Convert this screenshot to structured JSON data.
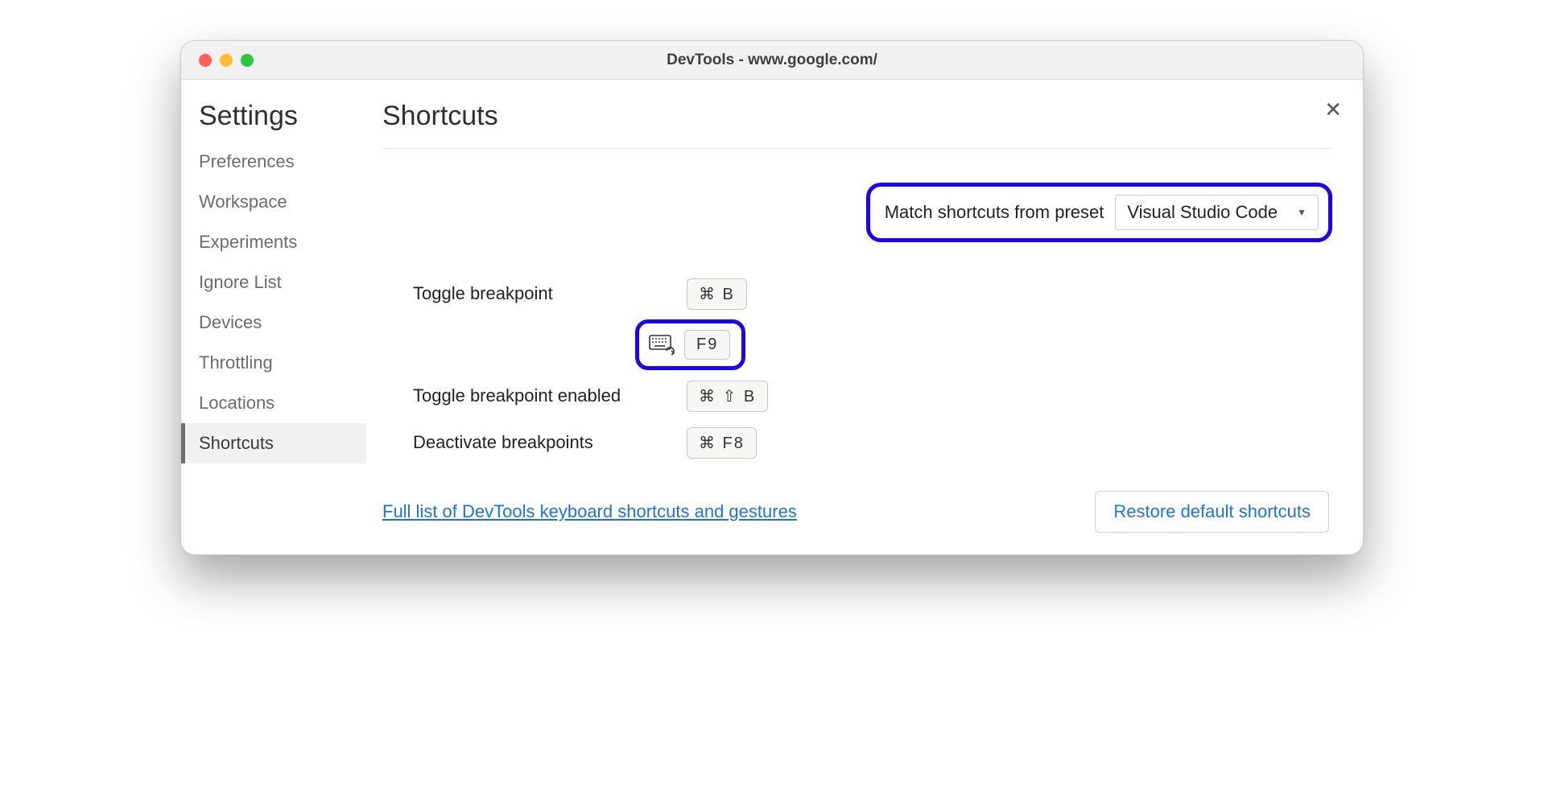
{
  "window_title": "DevTools - www.google.com/",
  "sidebar": {
    "heading": "Settings",
    "items": [
      {
        "label": "Preferences"
      },
      {
        "label": "Workspace"
      },
      {
        "label": "Experiments"
      },
      {
        "label": "Ignore List"
      },
      {
        "label": "Devices"
      },
      {
        "label": "Throttling"
      },
      {
        "label": "Locations"
      },
      {
        "label": "Shortcuts"
      }
    ],
    "active_index": 7
  },
  "page": {
    "title": "Shortcuts",
    "preset": {
      "label": "Match shortcuts from preset",
      "selected": "Visual Studio Code"
    },
    "shortcuts": [
      {
        "label": "Toggle breakpoint",
        "keys": "⌘ B"
      },
      {
        "label": "",
        "keys": "F9",
        "highlighted": true,
        "has_reset_icon": true
      },
      {
        "label": "Toggle breakpoint enabled",
        "keys": "⌘ ⇧ B"
      },
      {
        "label": "Deactivate breakpoints",
        "keys": "⌘ F8"
      }
    ],
    "link": "Full list of DevTools keyboard shortcuts and gestures",
    "restore_button": "Restore default shortcuts"
  }
}
